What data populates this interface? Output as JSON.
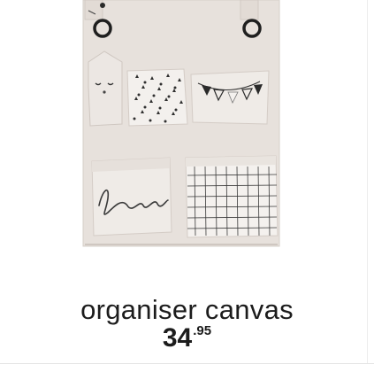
{
  "product": {
    "title": "organiser canvas",
    "price_integer": "34",
    "price_decimal": ".95",
    "image_text": "love"
  },
  "colors": {
    "canvas": "#e7e1dc",
    "canvas_shadow": "#d8d1cb",
    "pocket": "#efebe7",
    "ink": "#2a2a2a",
    "text": "#1c1c1c"
  }
}
